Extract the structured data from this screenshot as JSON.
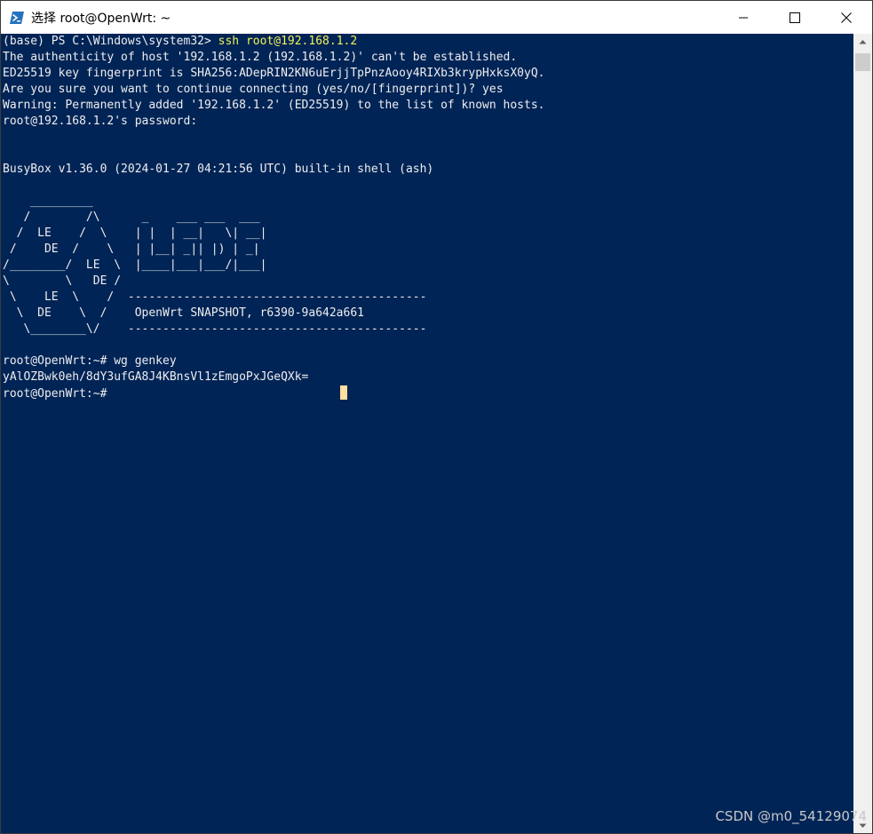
{
  "window": {
    "title": "选择 root@OpenWrt: ~",
    "icons": {
      "app": "powershell-icon",
      "minimize": "minimize-icon",
      "maximize": "maximize-icon",
      "close": "close-icon"
    },
    "colors": {
      "terminal_bg": "#012456",
      "terminal_fg": "#eeeeee",
      "command_highlight": "#f2f25a",
      "cursor": "#ffe0a0"
    }
  },
  "terminal": {
    "lines": [
      "(base) PS C:\\Windows\\system32> ",
      "The authenticity of host '192.168.1.2 (192.168.1.2)' can't be established.",
      "ED25519 key fingerprint is SHA256:ADepRIN2KN6uErjjTpPnzAooy4RIXb3krypHxksX0yQ.",
      "Are you sure you want to continue connecting (yes/no/[fingerprint])? yes",
      "Warning: Permanently added '192.168.1.2' (ED25519) to the list of known hosts.",
      "root@192.168.1.2's password:",
      "",
      "",
      "BusyBox v1.36.0 (2024-01-27 04:21:56 UTC) built-in shell (ash)",
      "",
      "    _________",
      "   /        /\\      _    ___ ___  ___",
      "  /  LE    /  \\    | |  | __|   \\| __|",
      " /    DE  /    \\   | |__| _|| |) | _|",
      "/________/  LE  \\  |____|___|___/|___|",
      "\\        \\   DE /",
      " \\    LE  \\    /  -------------------------------------------",
      "  \\  DE    \\  /    OpenWrt SNAPSHOT, r6390-9a642a661",
      "   \\________\\/    -------------------------------------------",
      "",
      "root@OpenWrt:~# wg genkey",
      "yAlOZBwk0eh/8dY3ufGA8J4KBnsVl1zEmgoPxJGeQXk=",
      "root@OpenWrt:~#"
    ],
    "first_command": "ssh root@192.168.1.2"
  },
  "watermark": "CSDN @m0_54129074"
}
